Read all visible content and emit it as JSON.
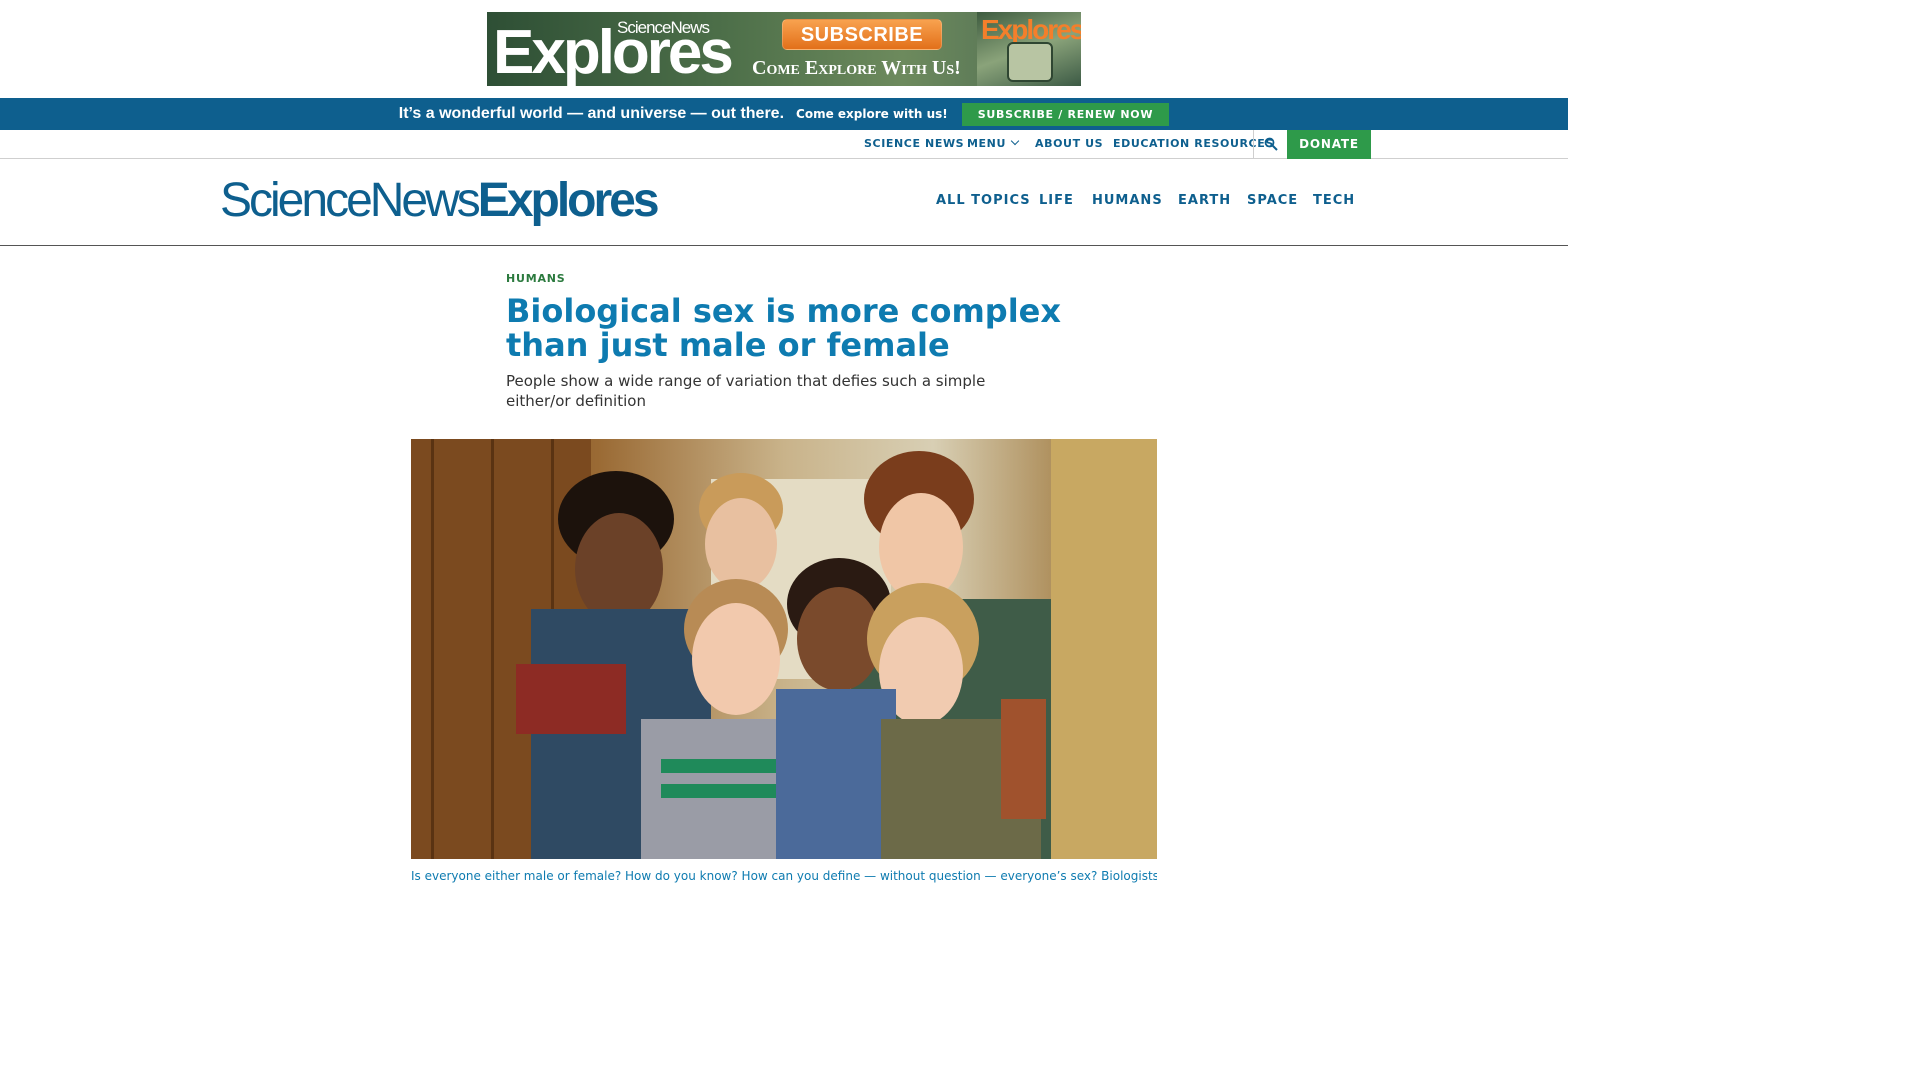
{
  "ad": {
    "brand_small": "ScienceNews",
    "brand": "Explores",
    "button": "SUBSCRIBE",
    "tagline": "Come Explore With Us!",
    "thumb_text": "Explores"
  },
  "promo": {
    "headline": "It’s a wonderful world — and universe — out there.",
    "small": "Come explore with us!",
    "button": "SUBSCRIBE / RENEW NOW"
  },
  "utility_nav": {
    "science_news": "SCIENCE NEWS",
    "menu": "MENU",
    "about": "ABOUT US",
    "education": "EDUCATION RESOURCES",
    "donate": "DONATE"
  },
  "logo": {
    "part1": "ScienceNews",
    "part2": "Explores"
  },
  "main_nav": [
    "ALL TOPICS",
    "LIFE",
    "HUMANS",
    "EARTH",
    "SPACE",
    "TECH"
  ],
  "article": {
    "kicker": "HUMANS",
    "headline": "Biological sex is more complex than just male or female",
    "dek": "People show a wide range of variation that defies such a simple either/or definition",
    "caption": "Is everyone either male or female? How do you know? How can you define — without question — everyone’s sex? Biologists weigh in on"
  },
  "colors": {
    "brand_blue": "#0e5f8e",
    "headline_blue": "#0e7bb0",
    "green": "#2e9a4a",
    "kicker_green": "#2b7a3e"
  },
  "icons": {
    "search": "search-icon",
    "menu_chevron": "chevron-down-icon"
  }
}
